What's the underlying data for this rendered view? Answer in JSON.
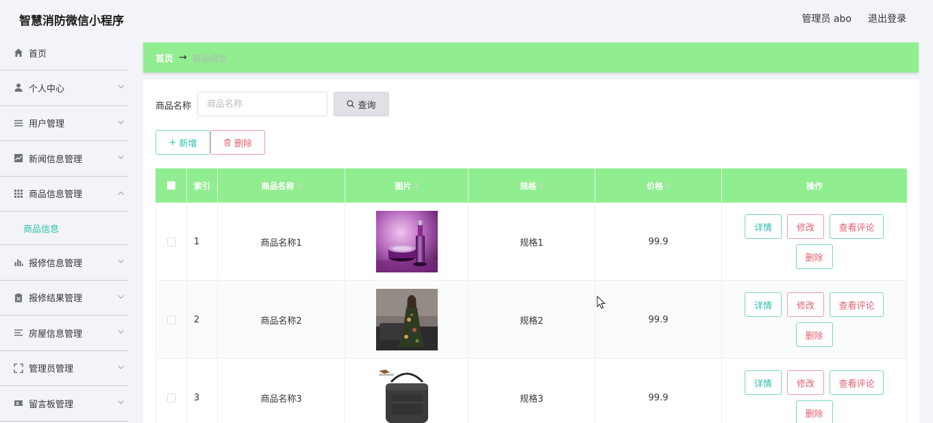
{
  "header": {
    "app_title": "智慧消防微信小程序",
    "admin_info": "管理员 abo",
    "logout": "退出登录"
  },
  "sidebar": {
    "items": [
      {
        "label": "首页",
        "icon": "home-icon"
      },
      {
        "label": "个人中心",
        "icon": "user-icon"
      },
      {
        "label": "用户管理",
        "icon": "list-icon"
      },
      {
        "label": "新闻信息管理",
        "icon": "chart-line-icon"
      },
      {
        "label": "商品信息管理",
        "icon": "grid-icon",
        "expanded": true,
        "sub": [
          {
            "label": "商品信息"
          }
        ]
      },
      {
        "label": "报修信息管理",
        "icon": "bar-chart-icon"
      },
      {
        "label": "报修结果管理",
        "icon": "clipboard-icon"
      },
      {
        "label": "房屋信息管理",
        "icon": "filter-list-icon"
      },
      {
        "label": "管理员管理",
        "icon": "fullscreen-icon"
      },
      {
        "label": "留言板管理",
        "icon": "ticket-icon"
      }
    ]
  },
  "breadcrumb": {
    "home": "首页",
    "separator": "→",
    "current": "商品信息"
  },
  "search": {
    "label": "商品名称",
    "placeholder": "商品名称",
    "button": "查询"
  },
  "actions": {
    "add": "新增",
    "delete": "删除"
  },
  "table": {
    "columns": [
      "索引",
      "商品名称",
      "图片",
      "规格",
      "价格",
      "操作"
    ],
    "rows": [
      {
        "index": "1",
        "name": "商品名称1",
        "image": "cosmetics-bottles",
        "spec": "规格1",
        "price": "99.9"
      },
      {
        "index": "2",
        "name": "商品名称2",
        "image": "woman-in-dress",
        "spec": "规格2",
        "price": "99.9"
      },
      {
        "index": "3",
        "name": "商品名称3",
        "image": "black-shoulder-bag",
        "spec": "规格3",
        "price": "99.9"
      }
    ],
    "row_actions": {
      "detail": "详情",
      "edit": "修改",
      "comments": "查看评论",
      "delete": "删除"
    }
  },
  "colors": {
    "accent_green": "#90ee90",
    "teal": "#29bfb0",
    "red": "#e0606e"
  }
}
